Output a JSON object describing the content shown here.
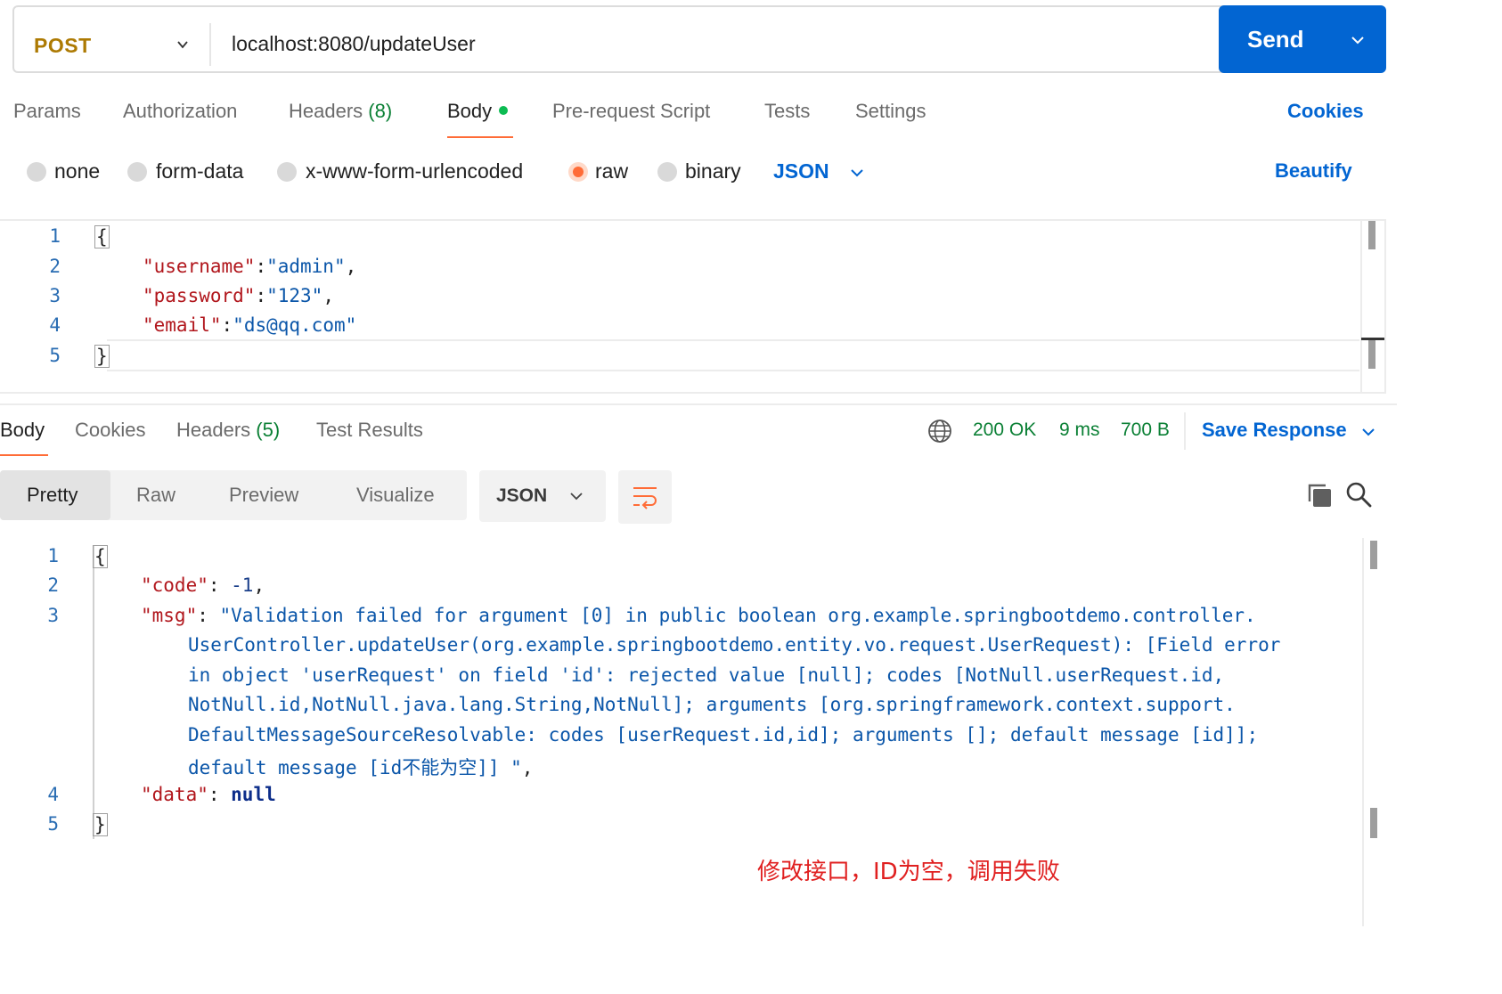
{
  "request": {
    "method": "POST",
    "url": "localhost:8080/updateUser",
    "send_label": "Send"
  },
  "request_tabs": {
    "params": "Params",
    "authorization": "Authorization",
    "headers": "Headers",
    "headers_count": "(8)",
    "body": "Body",
    "pre_request": "Pre-request Script",
    "tests": "Tests",
    "settings": "Settings",
    "cookies": "Cookies"
  },
  "body_types": {
    "none": "none",
    "form_data": "form-data",
    "urlencoded": "x-www-form-urlencoded",
    "raw": "raw",
    "binary": "binary",
    "selected": "raw",
    "language": "JSON",
    "beautify": "Beautify"
  },
  "request_body": {
    "line_numbers": [
      "1",
      "2",
      "3",
      "4",
      "5"
    ],
    "open": "{",
    "close": "}",
    "fields": [
      {
        "key": "\"username\"",
        "value": "\"admin\"",
        "trail": ","
      },
      {
        "key": "\"password\"",
        "value": "\"123\"",
        "trail": ","
      },
      {
        "key": "\"email\"",
        "value": "\"ds@qq.com\"",
        "trail": ""
      }
    ]
  },
  "response_tabs": {
    "body": "Body",
    "cookies": "Cookies",
    "headers": "Headers",
    "headers_count": "(5)",
    "test_results": "Test Results"
  },
  "response_status": {
    "status": "200 OK",
    "time": "9 ms",
    "size": "700 B",
    "save_response": "Save Response"
  },
  "view_modes": {
    "pretty": "Pretty",
    "raw": "Raw",
    "preview": "Preview",
    "visualize": "Visualize",
    "format": "JSON"
  },
  "response_body": {
    "line_numbers": [
      "1",
      "2",
      "3",
      "",
      "",
      "",
      "",
      "",
      "4",
      "5"
    ],
    "open": "{",
    "close": "}",
    "code_key": "\"code\"",
    "code_value": "-1",
    "msg_key": "\"msg\"",
    "msg_lines": [
      "\"Validation failed for argument [0] in public boolean org.example.springbootdemo.controller.",
      "UserController.updateUser(org.example.springbootdemo.entity.vo.request.UserRequest): [Field error",
      "in object 'userRequest' on field 'id': rejected value [null]; codes [NotNull.userRequest.id,",
      "NotNull.id,NotNull.java.lang.String,NotNull]; arguments [org.springframework.context.support.",
      "DefaultMessageSourceResolvable: codes [userRequest.id,id]; arguments []; default message [id]];",
      "default message [id不能为空]] \""
    ],
    "data_key": "\"data\"",
    "data_value": "null"
  },
  "annotation": "修改接口，ID为空，调用失败",
  "colors": {
    "accent": "#ff6c37",
    "primary": "#0265d2",
    "success": "#0b8035",
    "method": "#ad7a03",
    "annotation": "#e02020"
  }
}
